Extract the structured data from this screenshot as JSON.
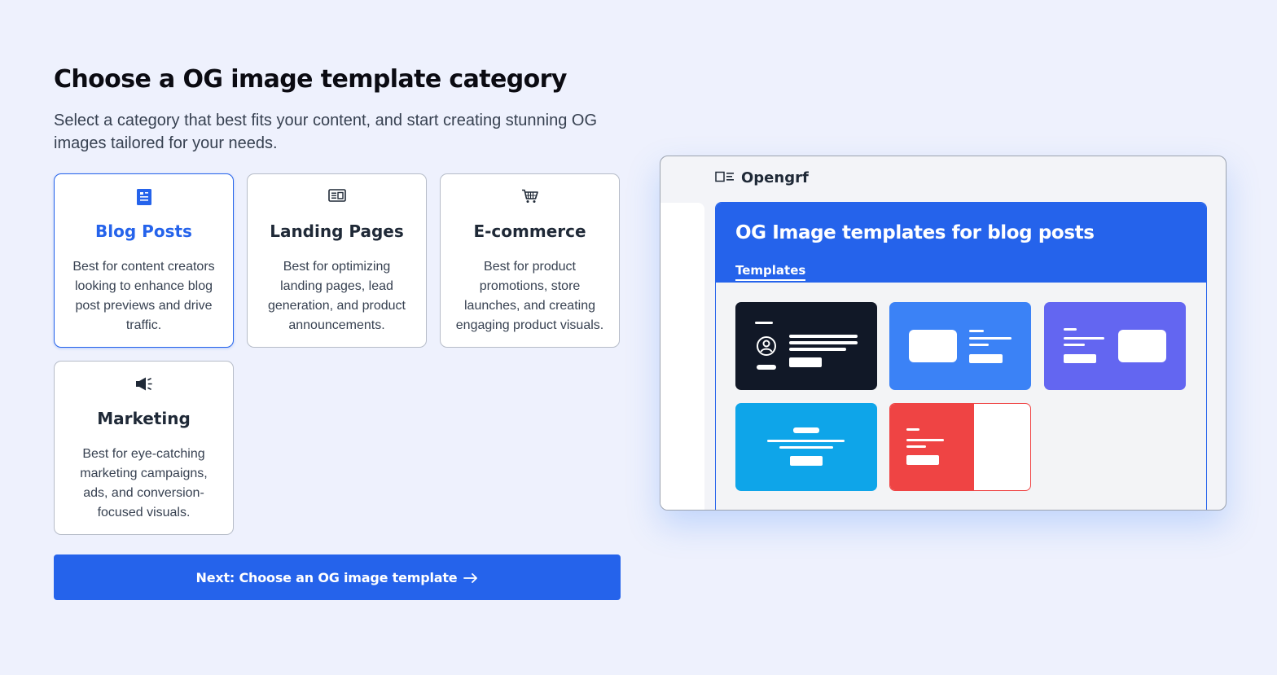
{
  "heading": "Choose a OG image template category",
  "subtitle": "Select a category that best fits your content, and start creating stunning OG images tailored for your needs.",
  "categories": [
    {
      "title": "Blog Posts",
      "desc": "Best for content creators looking to enhance blog post previews and drive traffic.",
      "icon": "document-icon",
      "selected": true
    },
    {
      "title": "Landing Pages",
      "desc": "Best for optimizing landing pages, lead generation, and product announcements.",
      "icon": "newspaper-icon",
      "selected": false
    },
    {
      "title": "E-commerce",
      "desc": "Best for product promotions, store launches, and creating engaging product visuals.",
      "icon": "cart-icon",
      "selected": false
    },
    {
      "title": "Marketing",
      "desc": "Best for eye-catching marketing campaigns, ads, and conversion-focused visuals.",
      "icon": "megaphone-icon",
      "selected": false
    }
  ],
  "next_button": {
    "label": "Next: Choose an OG image template",
    "icon": "arrow-right-icon"
  },
  "preview": {
    "brand": "Opengrf",
    "brand_icon": "logo-icon",
    "panel_title": "OG Image templates for blog posts",
    "tab": "Templates",
    "templates": [
      {
        "name": "dark",
        "color": "#111827"
      },
      {
        "name": "blue",
        "color": "#3b82f6"
      },
      {
        "name": "indigo",
        "color": "#6366f1"
      },
      {
        "name": "sky",
        "color": "#0ea5e9"
      },
      {
        "name": "red-split",
        "color": "#ef4444"
      }
    ]
  },
  "colors": {
    "accent": "#2563eb",
    "background": "#eef1fd"
  }
}
